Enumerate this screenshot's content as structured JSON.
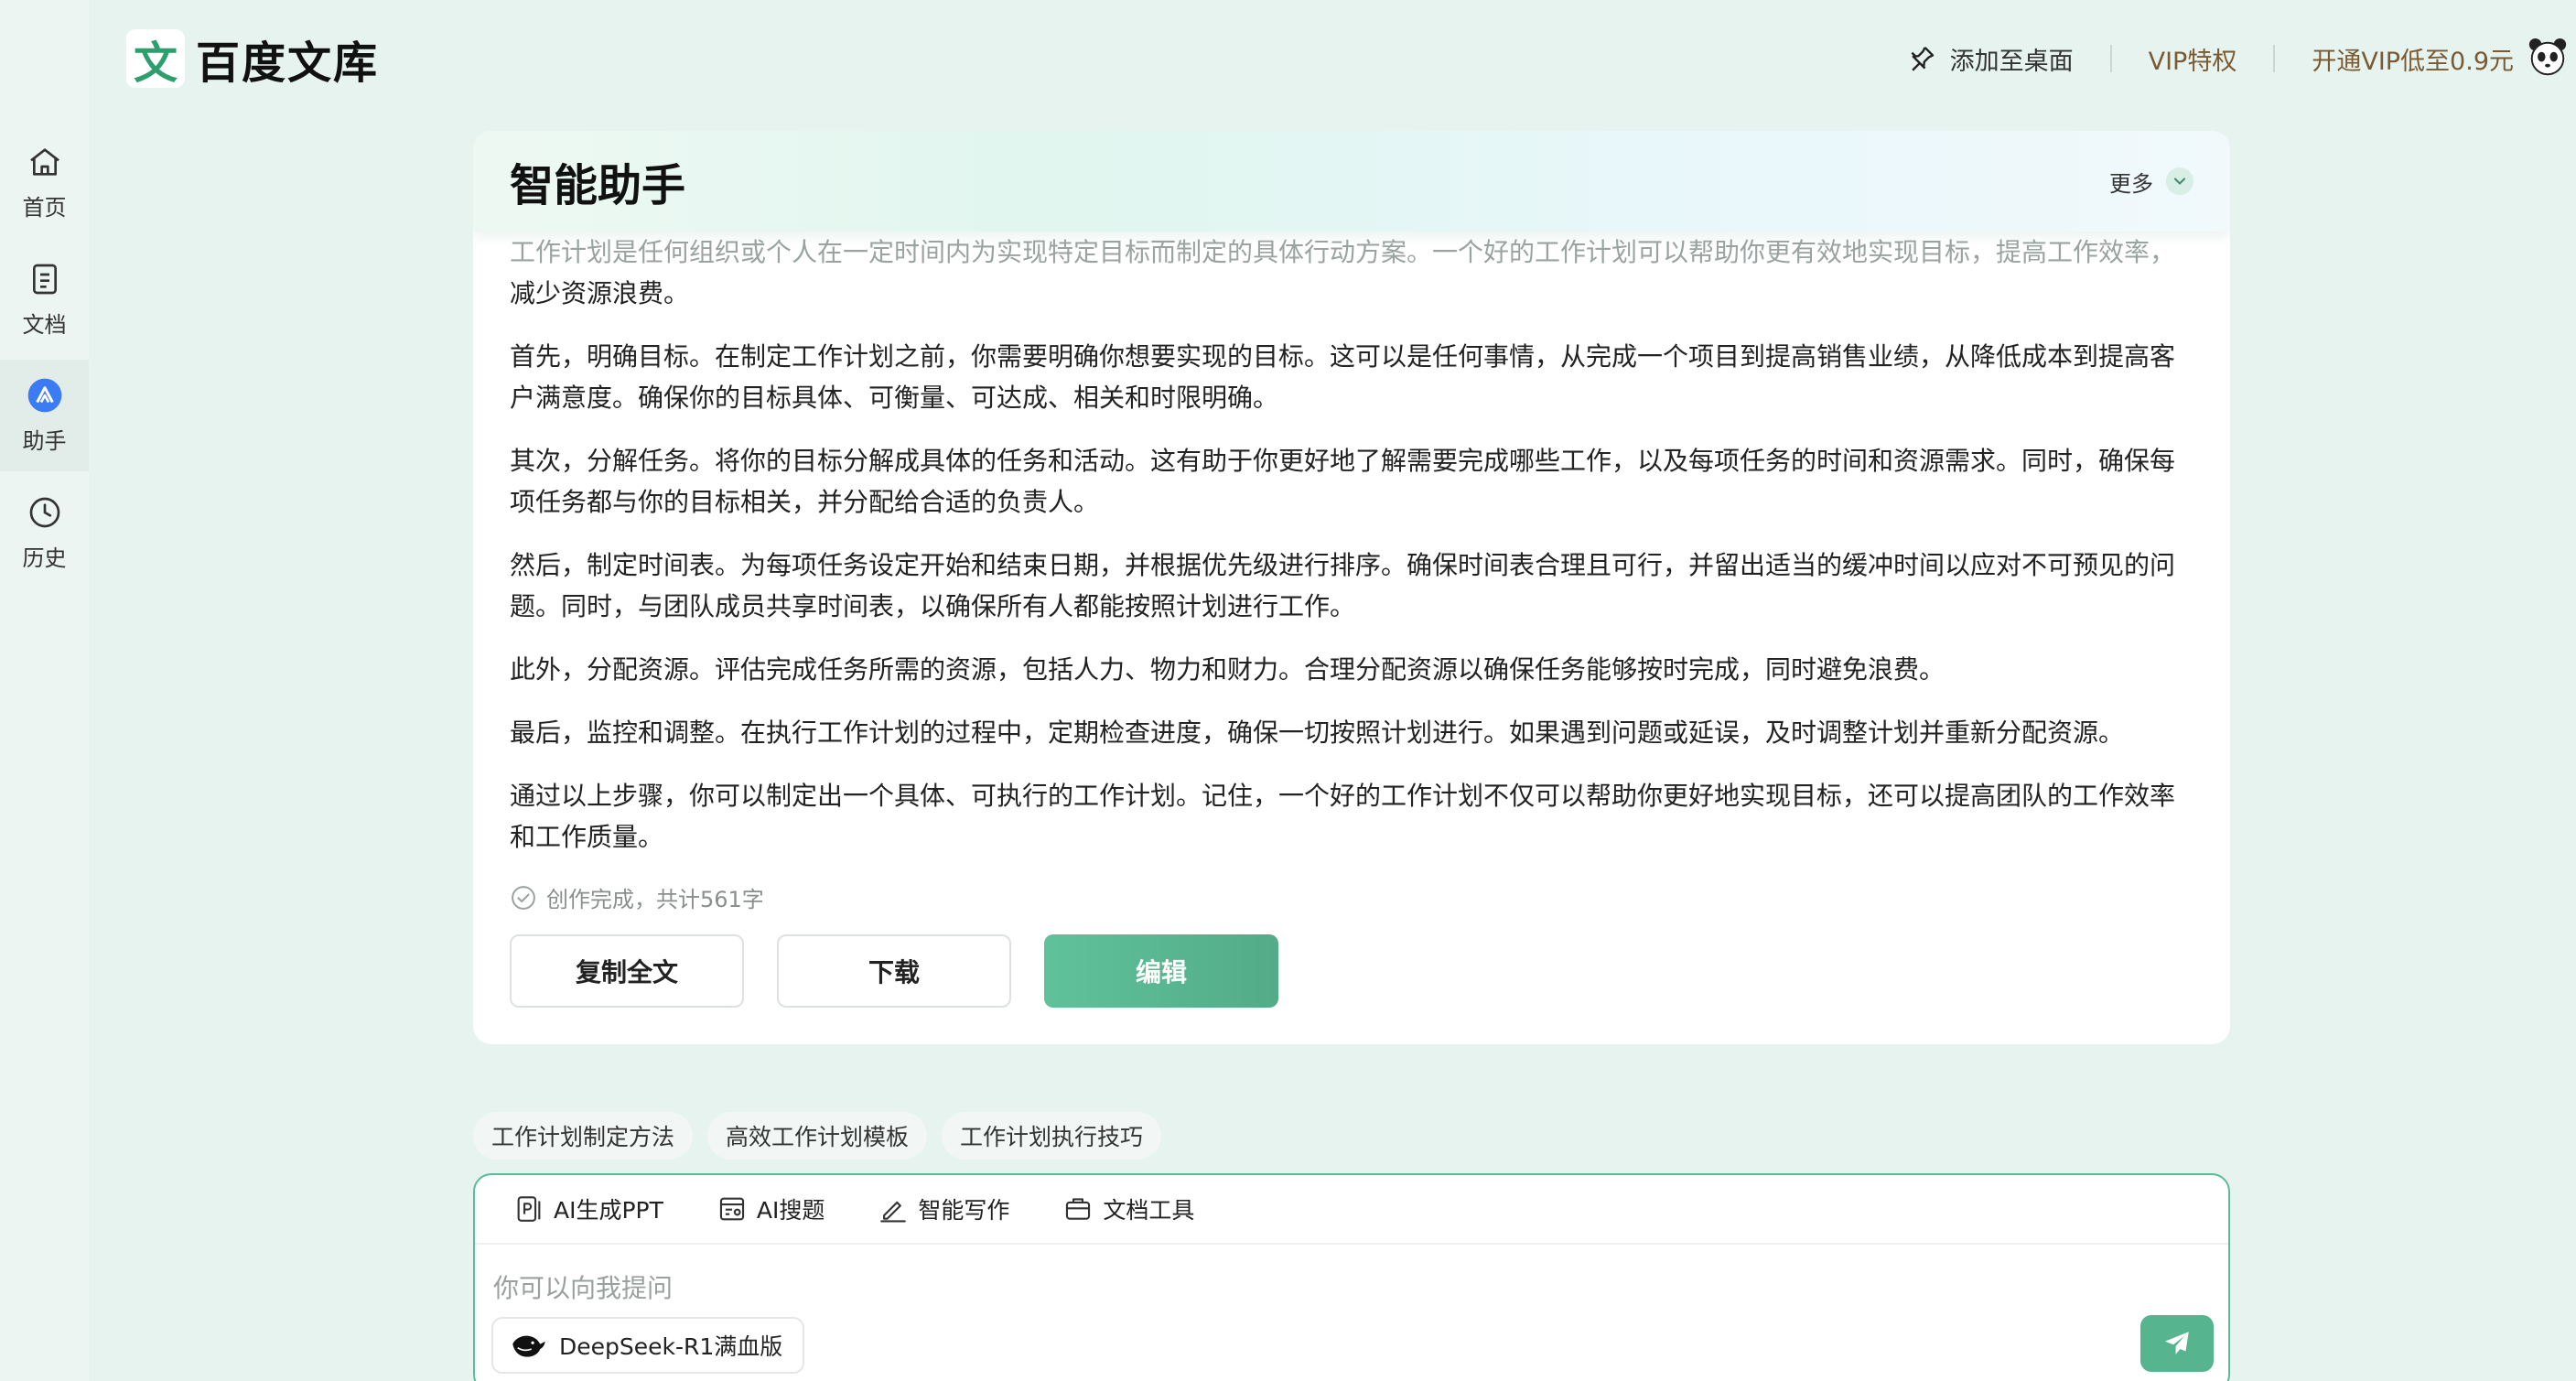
{
  "brand": {
    "mark": "文",
    "name": "百度文库"
  },
  "sidebar": {
    "items": [
      {
        "label": "首页",
        "icon": "home-icon"
      },
      {
        "label": "文档",
        "icon": "document-icon"
      },
      {
        "label": "助手",
        "icon": "assistant-icon",
        "active": true
      },
      {
        "label": "历史",
        "icon": "history-icon"
      }
    ]
  },
  "header": {
    "add_to_desktop": "添加至桌面",
    "vip_privileges": "VIP特权",
    "vip_offer": "开通VIP低至0.9元"
  },
  "card": {
    "title": "智能助手",
    "more_label": "更多",
    "paragraphs": [
      {
        "faded": "工作计划是任何组织或个人在一定时间内为实现特定目标而制定的具体行动方案。一个好的工作计划可以帮助你更有效地实现目标，提高工作效率，",
        "tail": "减少资源浪费。"
      },
      "首先，明确目标。在制定工作计划之前，你需要明确你想要实现的目标。这可以是任何事情，从完成一个项目到提高销售业绩，从降低成本到提高客户满意度。确保你的目标具体、可衡量、可达成、相关和时限明确。",
      "其次，分解任务。将你的目标分解成具体的任务和活动。这有助于你更好地了解需要完成哪些工作，以及每项任务的时间和资源需求。同时，确保每项任务都与你的目标相关，并分配给合适的负责人。",
      "然后，制定时间表。为每项任务设定开始和结束日期，并根据优先级进行排序。确保时间表合理且可行，并留出适当的缓冲时间以应对不可预见的问题。同时，与团队成员共享时间表，以确保所有人都能按照计划进行工作。",
      "此外，分配资源。评估完成任务所需的资源，包括人力、物力和财力。合理分配资源以确保任务能够按时完成，同时避免浪费。",
      "最后，监控和调整。在执行工作计划的过程中，定期检查进度，确保一切按照计划进行。如果遇到问题或延误，及时调整计划并重新分配资源。",
      "通过以上步骤，你可以制定出一个具体、可执行的工作计划。记住，一个好的工作计划不仅可以帮助你更好地实现目标，还可以提高团队的工作效率和工作质量。"
    ],
    "status": "创作完成，共计561字",
    "copy_label": "复制全文",
    "download_label": "下载",
    "edit_label": "编辑"
  },
  "suggestions": [
    "工作计划制定方法",
    "高效工作计划模板",
    "工作计划执行技巧"
  ],
  "composer": {
    "tools": [
      {
        "label": "AI生成PPT",
        "icon": "ppt-icon"
      },
      {
        "label": "AI搜题",
        "icon": "search-question-icon"
      },
      {
        "label": "智能写作",
        "icon": "pen-icon"
      },
      {
        "label": "文档工具",
        "icon": "toolbox-icon"
      }
    ],
    "placeholder": "你可以向我提问",
    "model_label": "DeepSeek-R1满血版"
  },
  "colors": {
    "accent": "#56b58f",
    "background": "#e6f3ef",
    "vip": "#7a5a32"
  }
}
